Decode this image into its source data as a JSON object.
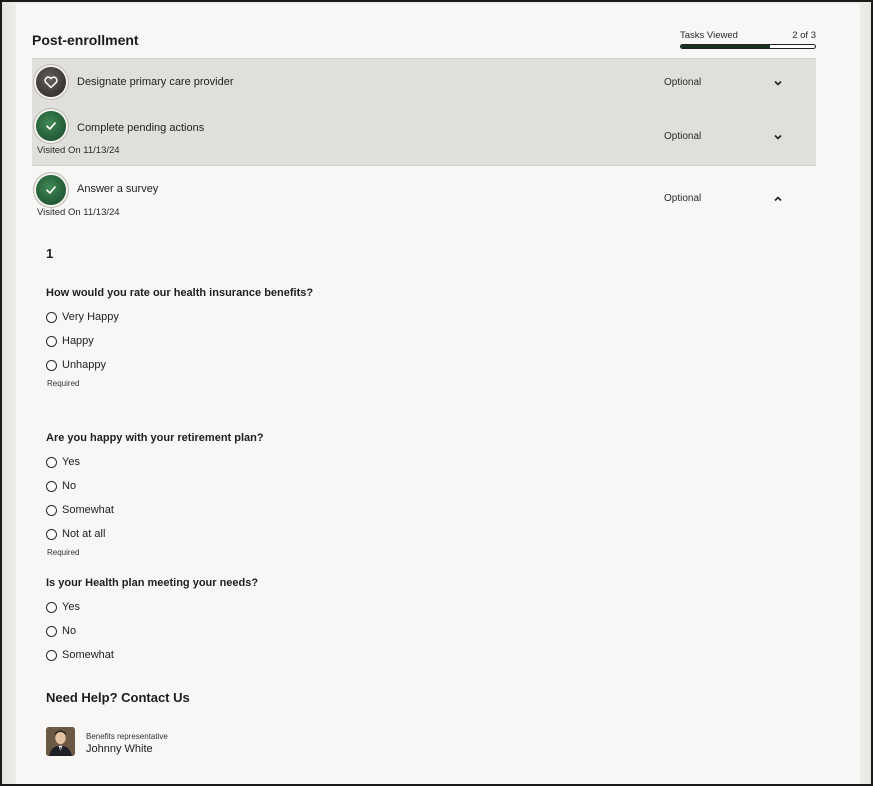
{
  "header": {
    "title": "Post-enrollment",
    "tasks_viewed_label": "Tasks Viewed",
    "tasks_viewed_count": "2 of 3",
    "tasks_viewed_progress": 0.6667
  },
  "tasks": [
    {
      "label": "Designate primary care provider",
      "status": "Optional",
      "visited": "",
      "icon": "heart-icon",
      "expanded": false
    },
    {
      "label": "Complete pending actions",
      "status": "Optional",
      "visited": "Visited On 11/13/24",
      "icon": "check-icon",
      "expanded": false
    },
    {
      "label": "Answer a survey",
      "status": "Optional",
      "visited": "Visited On 11/13/24",
      "icon": "check-icon",
      "expanded": true
    }
  ],
  "survey": {
    "number": "1",
    "questions": [
      {
        "title": "How would you rate our health insurance benefits?",
        "options": [
          "Very Happy",
          "Happy",
          "Unhappy"
        ],
        "required": "Required"
      },
      {
        "title": "Are you happy with your retirement plan?",
        "options": [
          "Yes",
          "No",
          "Somewhat",
          "Not at all"
        ],
        "required": "Required"
      },
      {
        "title": "Is your Health plan meeting your needs?",
        "options": [
          "Yes",
          "No",
          "Somewhat"
        ],
        "required": ""
      }
    ]
  },
  "help": {
    "title": "Need Help? Contact Us",
    "rep_role": "Benefits representative",
    "rep_name": "Johnny White"
  },
  "colors": {
    "progress_fill": "#16301f",
    "task_highlight_bg": "#e0dfdb",
    "check_icon_bg": "#27603a",
    "heart_icon_bg": "#403a36"
  }
}
